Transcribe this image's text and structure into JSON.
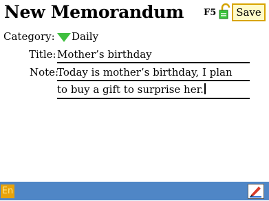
{
  "header": {
    "title": "New Memorandum",
    "shortcut": "F5",
    "save_label": "Save"
  },
  "form": {
    "category_label": "Category:",
    "category_value": "Daily",
    "title_label": "Title:",
    "title_value": "Mother’s birthday",
    "note_label": "Note:",
    "note_lines": [
      "Today is mother’s birthday, I plan",
      "to buy a gift to surprise her."
    ]
  },
  "bottom": {
    "ime_label": "En"
  },
  "icons": {
    "lock": "lock-icon",
    "dropdown": "dropdown-arrow-icon",
    "edit": "pen-edit-icon"
  },
  "colors": {
    "accent_bar": "#4f86c6",
    "save_border": "#d8a400",
    "save_bg": "#fffbc8",
    "dropdown_green": "#3fbf3f",
    "ime_bg": "#e7a20a"
  }
}
